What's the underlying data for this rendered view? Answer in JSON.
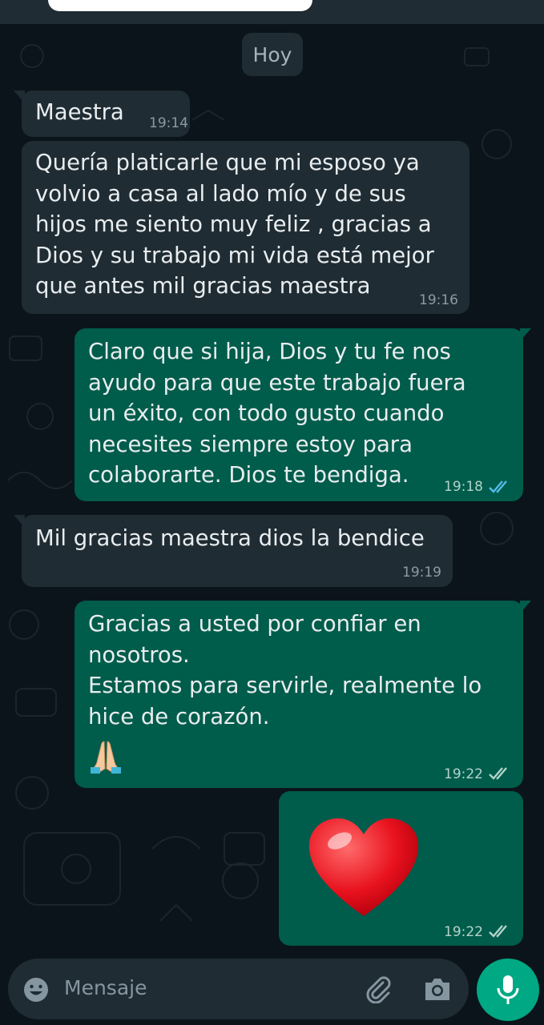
{
  "chat": {
    "date_chip": "Hoy",
    "messages": [
      {
        "direction": "incoming",
        "text": "Maestra",
        "time": "19:14"
      },
      {
        "direction": "incoming",
        "text": "Quería platicarle que mi esposo ya\nvolvio a casa al lado mío y de sus\nhijos me siento muy feliz , gracias a\nDios y su trabajo mi vida está mejor\nque antes mil gracias maestra",
        "time": "19:16"
      },
      {
        "direction": "outgoing",
        "text": "Claro que si hija, Dios y tu fe nos\nayudo para que este trabajo fuera\nun éxito, con todo gusto cuando\nnecesites siempre estoy para\ncolaborarte. Dios te bendiga.",
        "time": "19:18",
        "status": "read"
      },
      {
        "direction": "incoming",
        "text": "Mil gracias maestra dios la bendice",
        "time": "19:19"
      },
      {
        "direction": "outgoing",
        "text": "Gracias a usted por confiar en\nnosotros.\nEstamos para servirle, realmente lo\nhice de corazón.",
        "emoji": "folded-hands",
        "time": "19:22",
        "status": "delivered"
      },
      {
        "direction": "outgoing",
        "emoji": "red-heart",
        "time": "19:22",
        "status": "delivered"
      }
    ]
  },
  "composer": {
    "placeholder": "Mensaje",
    "icons": [
      "emoji-icon",
      "attach-icon",
      "camera-icon",
      "mic-icon"
    ]
  },
  "colors": {
    "background": "#0b141a",
    "incoming_bubble": "#1f2c34",
    "outgoing_bubble": "#005c4b",
    "read_ticks": "#53bdeb",
    "accent": "#00a884"
  }
}
